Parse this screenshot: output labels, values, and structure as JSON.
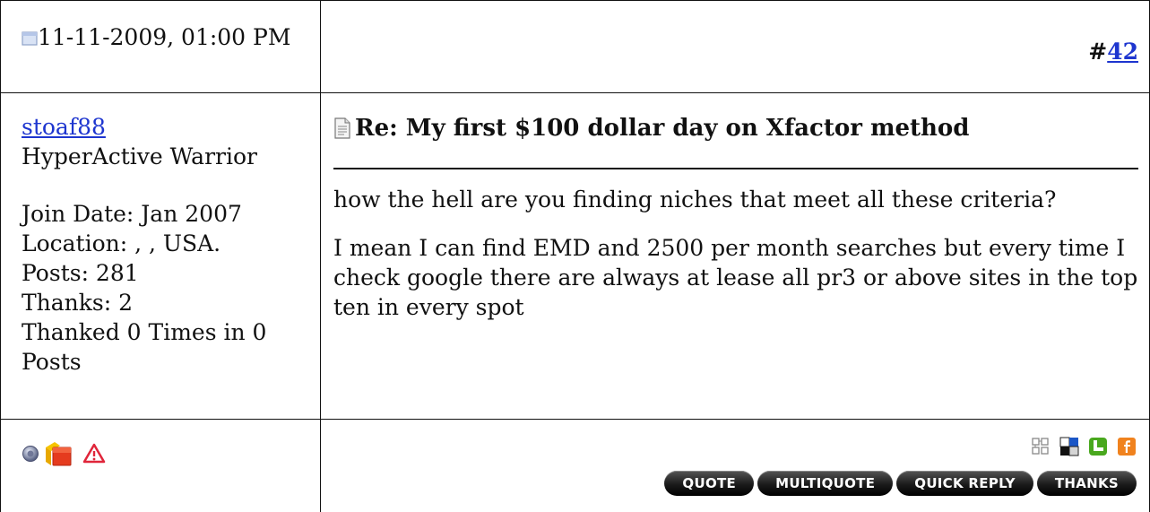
{
  "post": {
    "date": "11-11-2009, 01:00 PM",
    "number_prefix": "#",
    "number": "42"
  },
  "user": {
    "name": "stoaf88",
    "rank": "HyperActive Warrior",
    "join_date": "Join Date: Jan 2007",
    "location": "Location: , , USA.",
    "posts": "Posts: 281",
    "thanks": "Thanks: 2",
    "thanked": "Thanked 0 Times in 0 Posts"
  },
  "message": {
    "title": "Re: My first $100 dollar day on Xfactor method",
    "paragraphs": [
      "how the hell are you finding niches that meet all these criteria?",
      "I mean I can find EMD and 2500 per month searches but every time I check google there are always at lease all pr3 or above sites in the top ten in every spot"
    ]
  },
  "icons": {
    "status": [
      "offline-status-icon",
      "reputation-icon",
      "report-post-icon"
    ],
    "social": [
      "share-icon",
      "delicious-icon",
      "tweet-icon",
      "facebook-icon"
    ]
  },
  "buttons": {
    "quote": "QUOTE",
    "multiquote": "MULTIQUOTE",
    "quick_reply": "QUICK REPLY",
    "thanks": "THANKS"
  }
}
